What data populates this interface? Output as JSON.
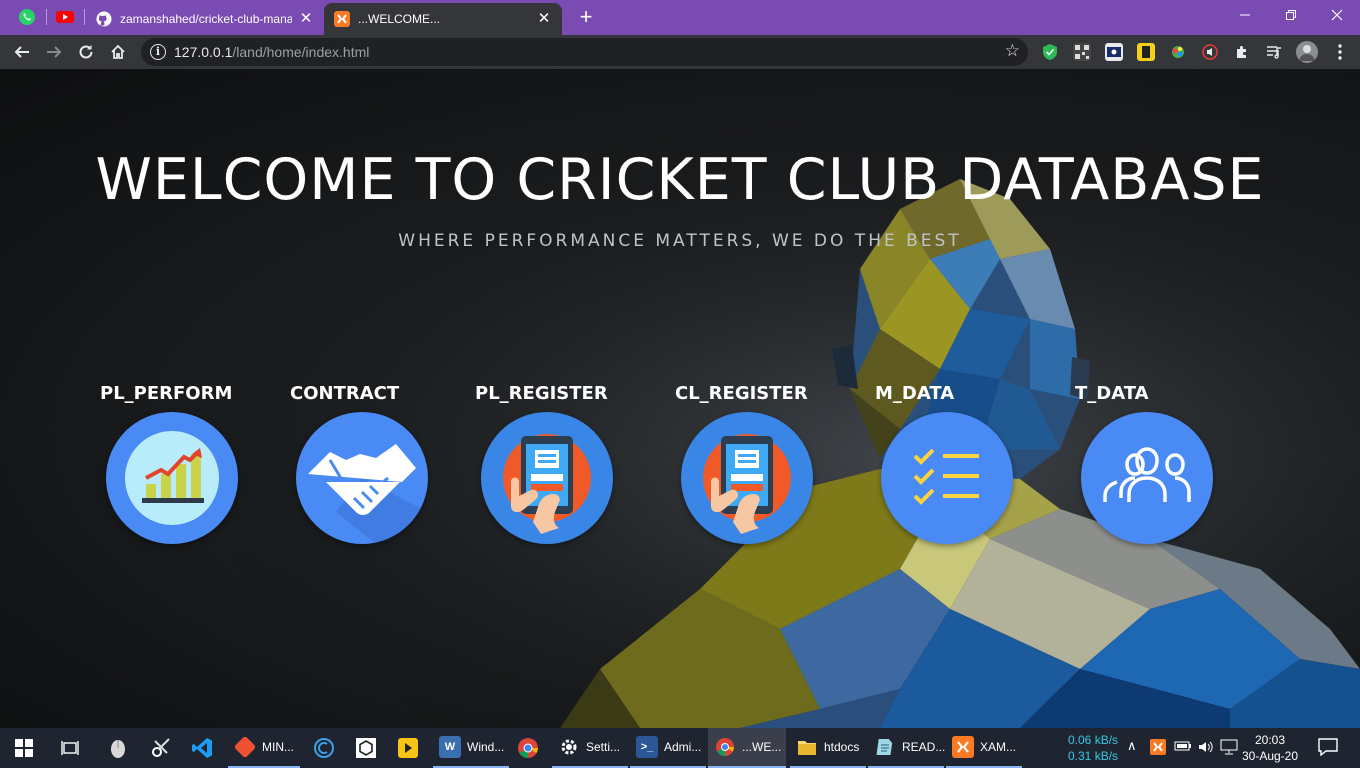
{
  "browser": {
    "pinned_tabs": [
      {
        "name": "whatsapp",
        "icon": "whatsapp-icon"
      },
      {
        "name": "youtube",
        "icon": "youtube-icon"
      }
    ],
    "tabs": [
      {
        "title": "zamanshahed/cricket-club-mana",
        "icon": "github-icon",
        "active": false
      },
      {
        "title": "...WELCOME...",
        "icon": "xampp-icon",
        "active": true
      }
    ],
    "new_tab_label": "+",
    "url_host": "127.0.0.1",
    "url_path": "/land/home/index.html",
    "colors": {
      "tabstrip": "#7a4cb3",
      "toolbar": "#35363a"
    }
  },
  "page": {
    "title": "WELCOME TO CRICKET CLUB DATABASE",
    "subtitle": "WHERE PERFORMANCE MATTERS, WE DO THE BEST",
    "modules": [
      {
        "label": "PL_PERFORM",
        "icon": "growth-chart-icon"
      },
      {
        "label": "CONTRACT",
        "icon": "handshake-icon"
      },
      {
        "label": "PL_REGISTER",
        "icon": "tablet-register-icon"
      },
      {
        "label": "CL_REGISTER",
        "icon": "tablet-register-icon"
      },
      {
        "label": "M_DATA",
        "icon": "checklist-icon"
      },
      {
        "label": "T_DATA",
        "icon": "team-icon"
      }
    ],
    "colors": {
      "circle": "#4a8af4",
      "text": "#ffffff"
    }
  },
  "taskbar": {
    "apps": [
      {
        "label": "MIN...",
        "icon": "git-icon"
      },
      {
        "label": "Wind...",
        "icon": "windows-explorer-icon"
      },
      {
        "label": "Setti...",
        "icon": "settings-icon"
      },
      {
        "label": "Admi...",
        "icon": "powershell-icon"
      },
      {
        "label": "...WE...",
        "icon": "chrome-icon"
      },
      {
        "label": "htdocs",
        "icon": "folder-icon"
      },
      {
        "label": "READ...",
        "icon": "notepad-icon"
      },
      {
        "label": "XAM...",
        "icon": "xampp-icon"
      }
    ],
    "net_up": "0.06 kB/s",
    "net_down": "0.31 kB/s",
    "time": "20:03",
    "date": "30-Aug-20"
  }
}
